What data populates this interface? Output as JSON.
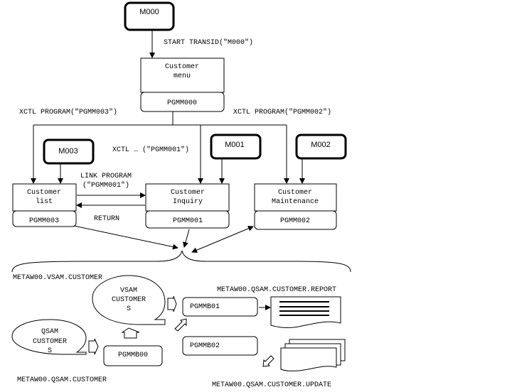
{
  "maps": {
    "m000": "M000",
    "m001": "M001",
    "m002": "M002",
    "m003": "M003"
  },
  "programs": {
    "menu": {
      "title_line1": "Customer",
      "title_line2": "menu",
      "pgm": "PGMM000"
    },
    "list": {
      "title_line1": "Customer",
      "title_line2": "list",
      "pgm": "PGMM003"
    },
    "inquiry": {
      "title_line1": "Customer",
      "title_line2": "Inquiry",
      "pgm": "PGMM001"
    },
    "maintenance": {
      "title_line1": "Customer",
      "title_line2": "Maintenance",
      "pgm": "PGMM002"
    }
  },
  "labels": {
    "start_transid": "START TRANSID(\"M000\")",
    "xctl_003": "XCTL PROGRAM(\"PGMM003\")",
    "xctl_002": "XCTL PROGRAM(\"PGMM002\")",
    "xctl_001": "XCTL … (\"PGMM001\")",
    "link_line1": "LINK PROGRAM",
    "link_line2": "(\"PGMM001\")",
    "return": "RETURN"
  },
  "datasets": {
    "vsam_name": "METAW00.VSAM.CUSTOMER",
    "vsam_line1": "VSAM",
    "vsam_line2": "CUSTOMER",
    "vsam_line3": "S",
    "qsam_name": "METAW00.QSAM.CUSTOMER",
    "qsam_line1": "QSAM",
    "qsam_line2": "CUSTOMER",
    "qsam_line3": "S",
    "report_name": "METAW00.QSAM.CUSTOMER.REPORT",
    "update_name": "METAW00.QSAM.CUSTOMER.UPDATE"
  },
  "batch": {
    "b00": "PGMMB00",
    "b01": "PGMMB01",
    "b02": "PGMMB02"
  }
}
